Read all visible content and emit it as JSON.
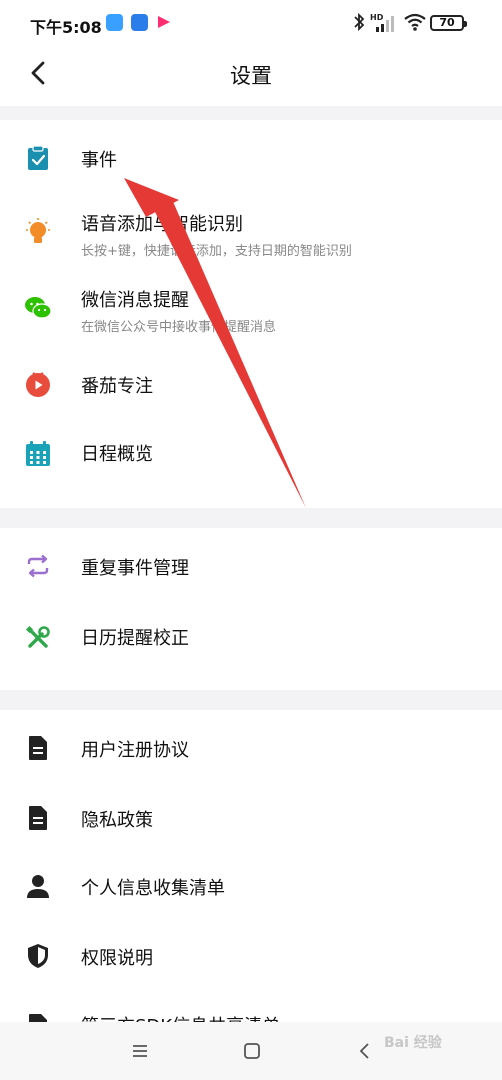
{
  "status_bar": {
    "time": "下午5:08",
    "battery": "70",
    "icons": [
      "chat-app-icon",
      "bluetooth-app-icon",
      "video-app-icon",
      "bluetooth-icon",
      "hd-signal-icon",
      "wifi-icon",
      "battery-icon"
    ]
  },
  "header": {
    "title": "设置"
  },
  "sections": [
    {
      "items": [
        {
          "label": "事件",
          "icon": "clipboard-check-icon",
          "color": "#1a8fb0"
        },
        {
          "label": "语音添加与智能识别",
          "sub": "长按+键，快捷语音添加，支持日期的智能识别",
          "icon": "lightbulb-icon",
          "color": "#f28c28"
        },
        {
          "label": "微信消息提醒",
          "sub": "在微信公众号中接收事件提醒消息",
          "icon": "wechat-icon",
          "color": "#2dc100"
        },
        {
          "label": "番茄专注",
          "icon": "tomato-timer-icon",
          "color": "#e74c3c"
        },
        {
          "label": "日程概览",
          "icon": "calendar-grid-icon",
          "color": "#1aa3b8"
        }
      ]
    },
    {
      "items": [
        {
          "label": "重复事件管理",
          "icon": "repeat-icon",
          "color": "#9b6fd0"
        },
        {
          "label": "日历提醒校正",
          "icon": "tools-icon",
          "color": "#2ea84a"
        }
      ]
    },
    {
      "items": [
        {
          "label": "用户注册协议",
          "icon": "document-icon",
          "color": "#222222"
        },
        {
          "label": "隐私政策",
          "icon": "document-icon",
          "color": "#222222"
        },
        {
          "label": "个人信息收集清单",
          "icon": "person-icon",
          "color": "#222222"
        },
        {
          "label": "权限说明",
          "icon": "shield-icon",
          "color": "#222222"
        },
        {
          "label": "第三方SDK信息共享清单",
          "icon": "document-icon",
          "color": "#222222"
        }
      ]
    }
  ],
  "nav_bar": {
    "buttons": [
      "menu-icon",
      "home-icon",
      "back-icon"
    ]
  },
  "watermark": "Bai 经验",
  "annotation_color": "#e53935"
}
